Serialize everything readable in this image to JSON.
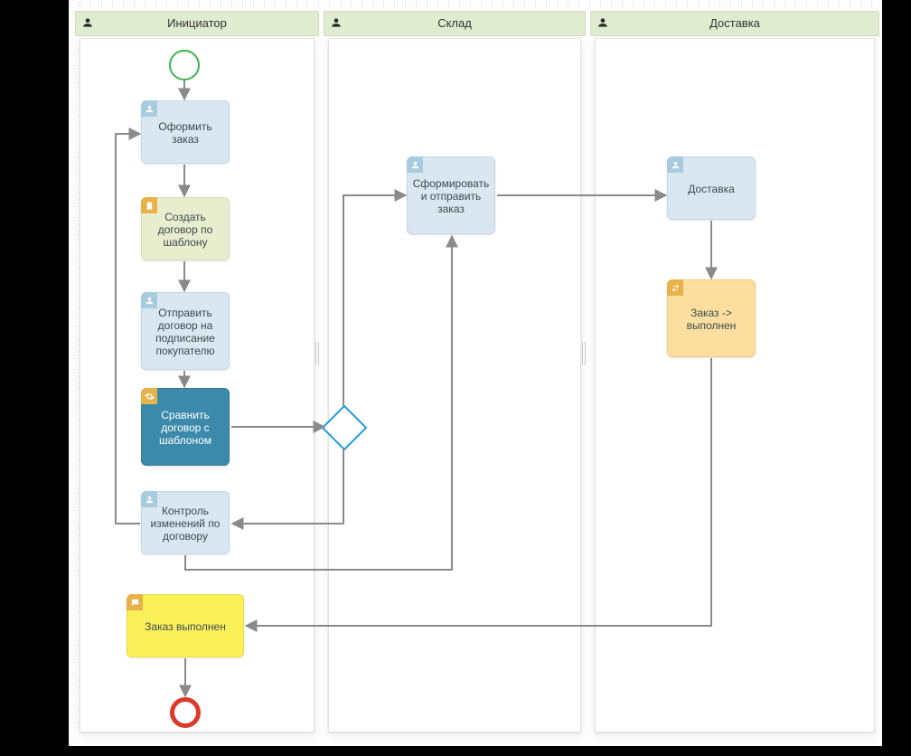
{
  "lanes": {
    "l1": {
      "title": "Инициатор"
    },
    "l2": {
      "title": "Склад"
    },
    "l3": {
      "title": "Доставка"
    }
  },
  "tasks": {
    "t_order": "Оформить заказ",
    "t_tmpl": "Создать договор по шаблону",
    "t_send": "Отправить договор на подписание покупателю",
    "t_cmp": "Сравнить договор с шаблоном",
    "t_ctrl": "Контроль изменений по договору",
    "t_done": "Заказ выполнен",
    "t_form": "Сформировать и отправить заказ",
    "t_deliv": "Доставка",
    "t_status": "Заказ -> выполнен"
  },
  "events": {
    "start": "start",
    "end": "end"
  },
  "icons": {
    "user": "user",
    "script": "script",
    "gear": "gear",
    "swap": "swap",
    "msg": "msg"
  }
}
